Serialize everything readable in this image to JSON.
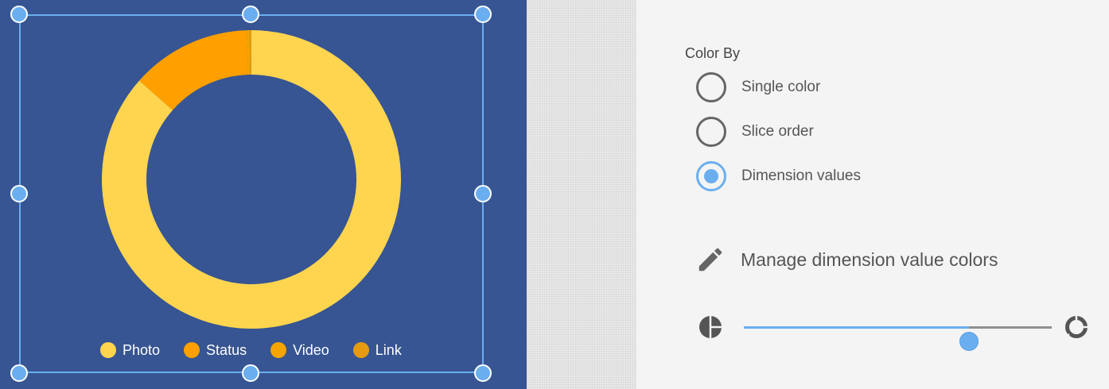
{
  "chart": {
    "chart_data": {
      "type": "pie",
      "style": "donut",
      "labels": [
        "Photo",
        "Status",
        "Video",
        "Link"
      ],
      "values": [
        86.5,
        13.0,
        0.3,
        0.2
      ],
      "unit": "percent (estimated from slice size)",
      "colors": [
        "#ffd54f",
        "#ffa000",
        "#f5a500",
        "#e69a10"
      ],
      "legend_position": "bottom"
    },
    "legend": [
      {
        "label": "Photo",
        "color": "#ffd54f"
      },
      {
        "label": "Status",
        "color": "#ffa000"
      },
      {
        "label": "Video",
        "color": "#f5a500"
      },
      {
        "label": "Link",
        "color": "#e69a10"
      }
    ],
    "selected": true
  },
  "panel": {
    "color_by_label": "Color By",
    "options": [
      {
        "label": "Single color",
        "checked": false
      },
      {
        "label": "Slice order",
        "checked": false
      },
      {
        "label": "Dimension values",
        "checked": true
      }
    ],
    "manage_label": "Manage dimension value colors",
    "manage_icon": "pencil-icon",
    "donut_hole_slider": {
      "min_icon": "pie-icon",
      "max_icon": "donut-icon",
      "value_fraction": 0.73
    }
  },
  "colors": {
    "canvas_bg": "#375592",
    "accent": "#6aaef0",
    "panel_bg": "#f4f4f4"
  }
}
